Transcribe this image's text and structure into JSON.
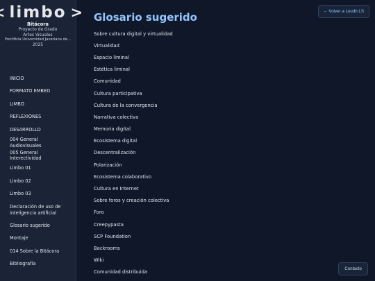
{
  "logo": {
    "left": "<",
    "word": "limbo",
    "right": ">"
  },
  "meta": {
    "title": "Bitácora",
    "line1": "Proyecto de Grado",
    "line2": "Artes Visuales",
    "university": "Pontificia Universidad Javeriana de...",
    "year": "2025"
  },
  "nav": [
    "INICIO",
    "FORMATO EMBED",
    "LIMBO",
    "REFLEXIONES",
    "DESARROLLO",
    "004 General Audiovisuales",
    "005 General Interectividad",
    "Limbo 01",
    "Limbo 02",
    "Limbo 03",
    "Declaración de uso de inteligencia artificial",
    "Glosario sugerido",
    "Montaje",
    "014 Sobre la Bitácora",
    "Bibliografía"
  ],
  "main": {
    "title": "Glosario sugerido",
    "back_label": "← Volver a Leudh LS",
    "contact_label": "Contacto",
    "terms": [
      "Sobre cultura digital y virtualidad",
      "Virtualidad",
      "Espacio liminal",
      "Estética liminal",
      "Comunidad",
      "Cultura participativa",
      "Cultura de la convergencia",
      "Narrativa colectiva",
      "Memoria digital",
      "Ecosistema digital",
      "Descentralización",
      "Polarización",
      "Ecosistema colaborativo",
      "Cultura en Internet",
      "Sobre foros y creación colectiva",
      "Foro",
      "Creepypasta",
      "SCP Foundation",
      "Backrooms",
      "Wiki",
      "Comunidad distribuida"
    ]
  }
}
